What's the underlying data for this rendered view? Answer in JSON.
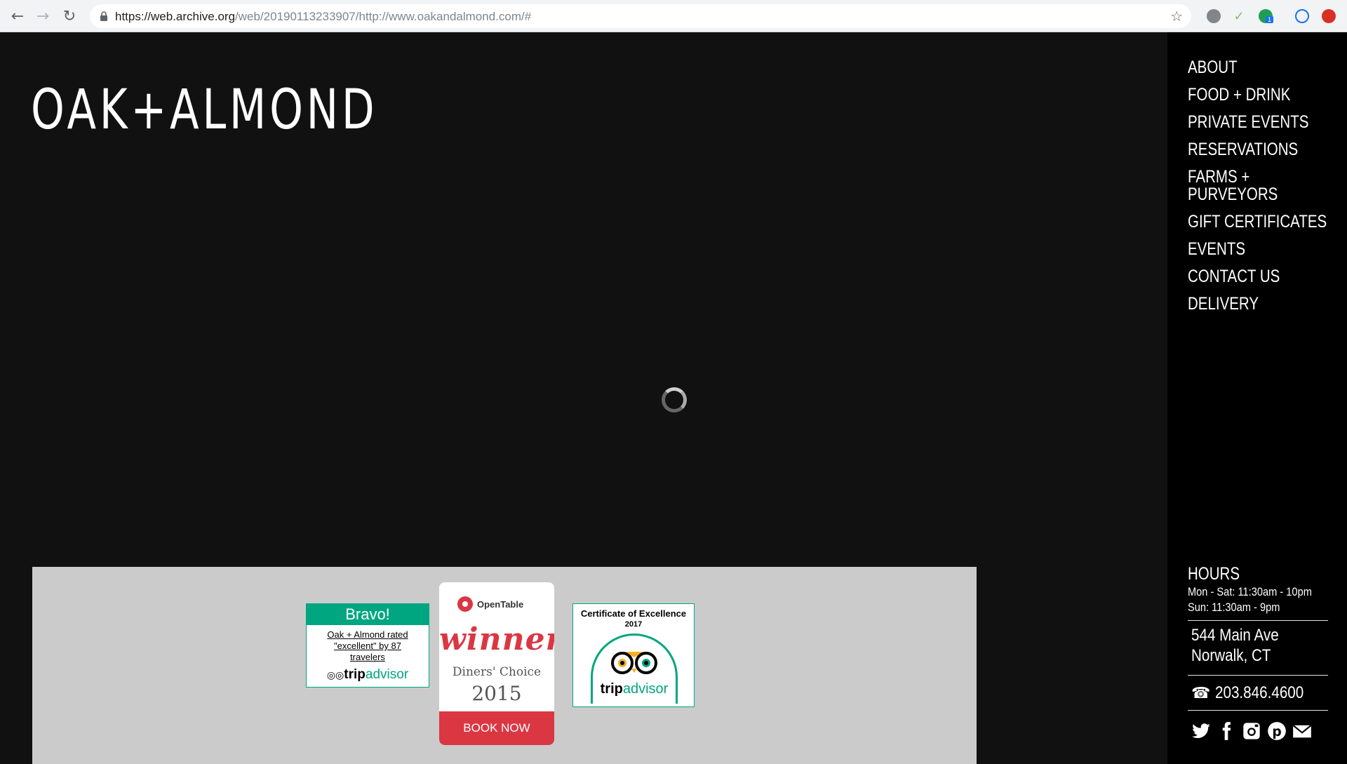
{
  "browser": {
    "url_host": "https://web.archive.org",
    "url_path": "/web/20190113233907/http://www.oakandalmond.com/#",
    "extension_badge": "1"
  },
  "site": {
    "logo": "OAK+ALMOND",
    "menu": [
      "ABOUT",
      "FOOD + DRINK",
      "PRIVATE EVENTS",
      "RESERVATIONS",
      "FARMS + PURVEYORS",
      "GIFT CERTIFICATES",
      "EVENTS",
      "CONTACT US",
      "DELIVERY"
    ],
    "hours_title": "HOURS",
    "hours": [
      "Mon - Sat: 11:30am - 10pm",
      "Sun: 11:30am - 9pm"
    ],
    "address": [
      "544 Main Ave",
      "Norwalk, CT"
    ],
    "phone": "203.846.4600"
  },
  "awards": {
    "bravo": {
      "heading": "Bravo!",
      "text": "Oak + Almond rated \"excellent\" by 87 travelers",
      "brand_a": "trip",
      "brand_b": "advisor"
    },
    "opentable": {
      "brand": "OpenTable",
      "winner": "winner",
      "subtitle": "Diners' Choice",
      "year": "2015",
      "button": "BOOK NOW"
    },
    "certificate": {
      "title": "Certificate of Excellence",
      "year": "2017",
      "brand_a": "trip",
      "brand_b": "advisor"
    }
  },
  "colors": {
    "page_bg": "#111111",
    "sidebar_bg": "#000000",
    "tripadvisor_green": "#00a680",
    "opentable_red": "#da3743"
  }
}
